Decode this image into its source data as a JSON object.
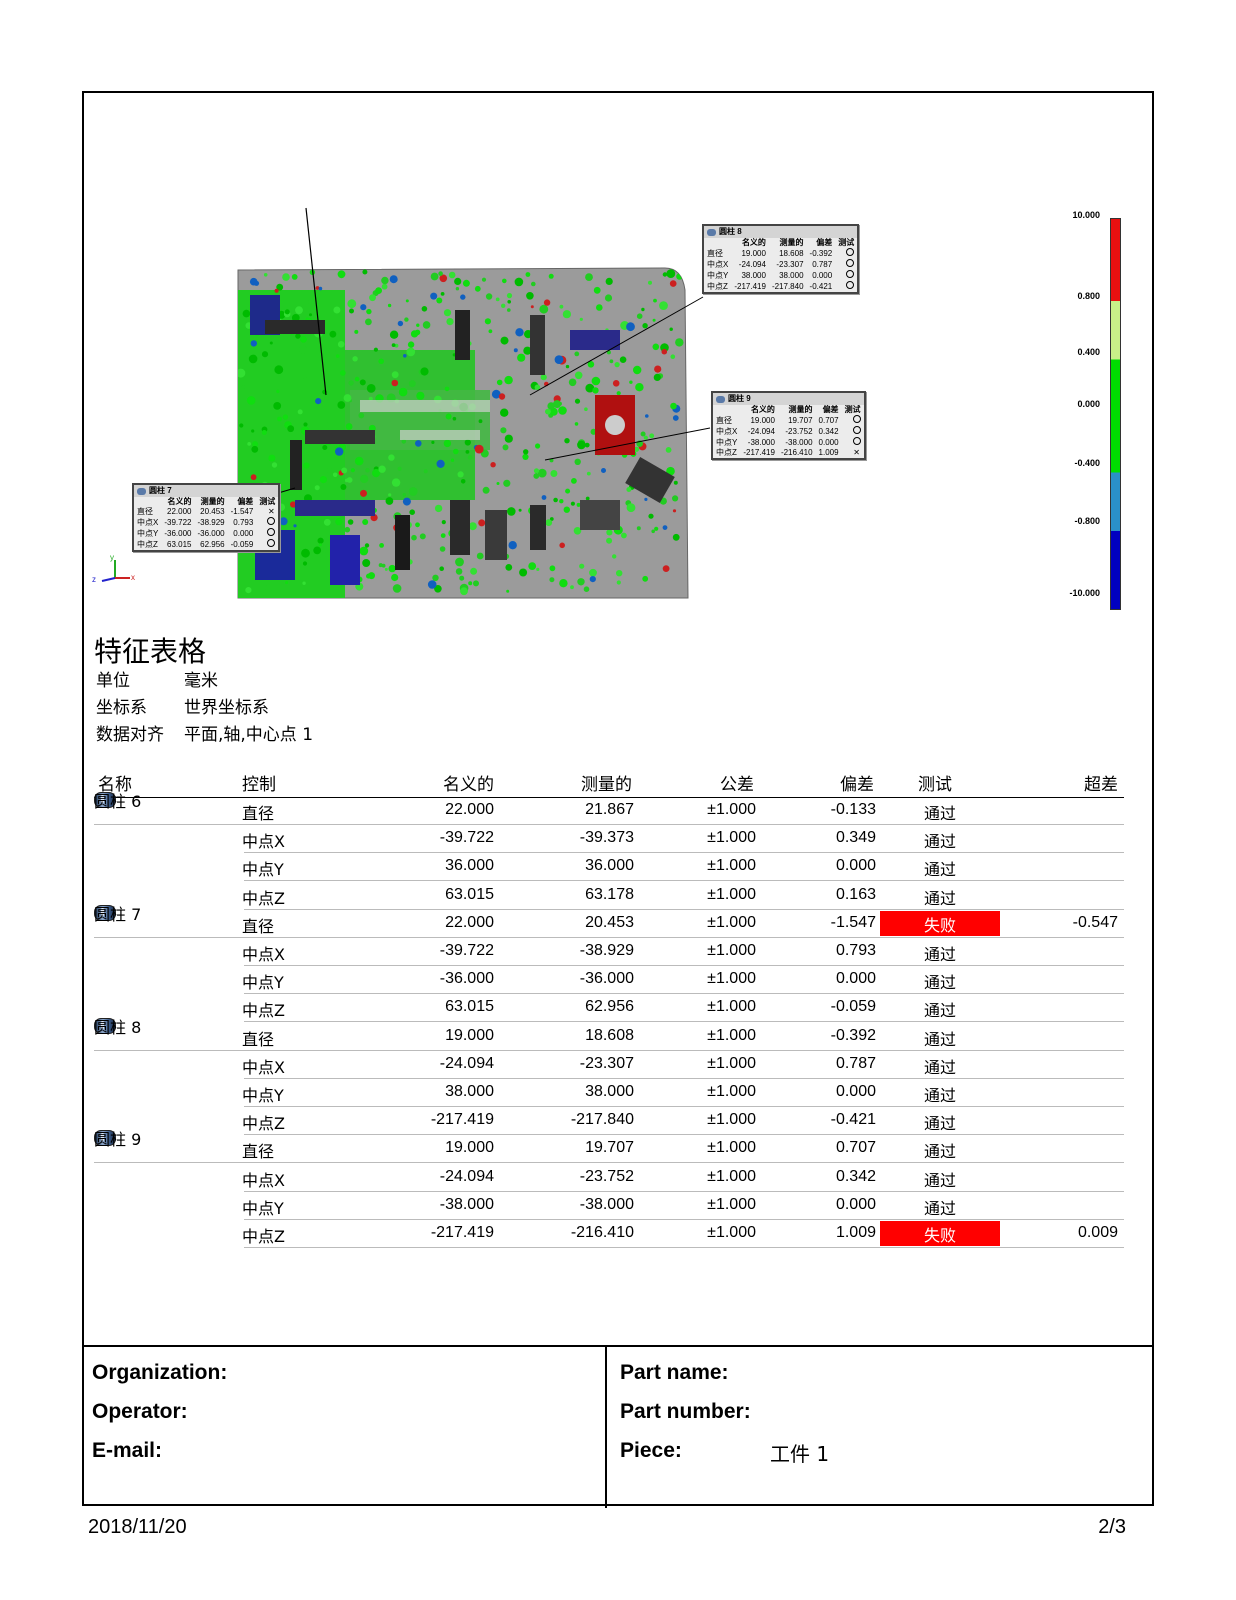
{
  "legend": {
    "labels": [
      "10.000",
      "0.800",
      "0.400",
      "0.000",
      "-0.400",
      "-0.800",
      "-10.000"
    ],
    "colors": {
      "high": "#e81010",
      "mid_high": "#c8f088",
      "mid": "#00dd00",
      "mid_low": "#2a90c8",
      "low": "#0000c0"
    }
  },
  "callouts": [
    {
      "title": "圆柱 8",
      "cols": [
        "",
        "名义的",
        "测量的",
        "偏差",
        "测试"
      ],
      "rows": [
        [
          "直径",
          "19.000",
          "18.608",
          "-0.392",
          "pass"
        ],
        [
          "中点X",
          "-24.094",
          "-23.307",
          "0.787",
          "pass"
        ],
        [
          "中点Y",
          "38.000",
          "38.000",
          "0.000",
          "pass"
        ],
        [
          "中点Z",
          "-217.419",
          "-217.840",
          "-0.421",
          "pass"
        ]
      ]
    },
    {
      "title": "圆柱 9",
      "cols": [
        "",
        "名义的",
        "测量的",
        "偏差",
        "测试"
      ],
      "rows": [
        [
          "直径",
          "19.000",
          "19.707",
          "0.707",
          "pass"
        ],
        [
          "中点X",
          "-24.094",
          "-23.752",
          "0.342",
          "pass"
        ],
        [
          "中点Y",
          "-38.000",
          "-38.000",
          "0.000",
          "pass"
        ],
        [
          "中点Z",
          "-217.419",
          "-216.410",
          "1.009",
          "fail"
        ]
      ]
    },
    {
      "title": "圆柱 7",
      "cols": [
        "",
        "名义的",
        "测量的",
        "偏差",
        "测试"
      ],
      "rows": [
        [
          "直径",
          "22.000",
          "20.453",
          "-1.547",
          "fail"
        ],
        [
          "中点X",
          "-39.722",
          "-38.929",
          "0.793",
          "pass"
        ],
        [
          "中点Y",
          "-36.000",
          "-36.000",
          "0.000",
          "pass"
        ],
        [
          "中点Z",
          "63.015",
          "62.956",
          "-0.059",
          "pass"
        ]
      ]
    }
  ],
  "axes": {
    "x": "x",
    "y": "y",
    "z": "z"
  },
  "title": "特征表格",
  "meta": [
    {
      "key": "单位",
      "value": "毫米"
    },
    {
      "key": "坐标系",
      "value": "世界坐标系"
    },
    {
      "key": "数据对齐",
      "value": "平面,轴,中心点 1"
    }
  ],
  "table": {
    "headers": {
      "name": "名称",
      "control": "控制",
      "nominal": "名义的",
      "measured": "测量的",
      "tolerance": "公差",
      "deviation": "偏差",
      "test": "测试",
      "out_of_tol": "超差"
    },
    "features": [
      {
        "name": "圆柱 6",
        "rows": [
          {
            "control": "直径",
            "nominal": "22.000",
            "measured": "21.867",
            "tolerance": "±1.000",
            "deviation": "-0.133",
            "test": "通过",
            "fail": false,
            "out": ""
          },
          {
            "control": "中点X",
            "nominal": "-39.722",
            "measured": "-39.373",
            "tolerance": "±1.000",
            "deviation": "0.349",
            "test": "通过",
            "fail": false,
            "out": ""
          },
          {
            "control": "中点Y",
            "nominal": "36.000",
            "measured": "36.000",
            "tolerance": "±1.000",
            "deviation": "0.000",
            "test": "通过",
            "fail": false,
            "out": ""
          },
          {
            "control": "中点Z",
            "nominal": "63.015",
            "measured": "63.178",
            "tolerance": "±1.000",
            "deviation": "0.163",
            "test": "通过",
            "fail": false,
            "out": ""
          }
        ]
      },
      {
        "name": "圆柱 7",
        "rows": [
          {
            "control": "直径",
            "nominal": "22.000",
            "measured": "20.453",
            "tolerance": "±1.000",
            "deviation": "-1.547",
            "test": "失败",
            "fail": true,
            "out": "-0.547"
          },
          {
            "control": "中点X",
            "nominal": "-39.722",
            "measured": "-38.929",
            "tolerance": "±1.000",
            "deviation": "0.793",
            "test": "通过",
            "fail": false,
            "out": ""
          },
          {
            "control": "中点Y",
            "nominal": "-36.000",
            "measured": "-36.000",
            "tolerance": "±1.000",
            "deviation": "0.000",
            "test": "通过",
            "fail": false,
            "out": ""
          },
          {
            "control": "中点Z",
            "nominal": "63.015",
            "measured": "62.956",
            "tolerance": "±1.000",
            "deviation": "-0.059",
            "test": "通过",
            "fail": false,
            "out": ""
          }
        ]
      },
      {
        "name": "圆柱 8",
        "rows": [
          {
            "control": "直径",
            "nominal": "19.000",
            "measured": "18.608",
            "tolerance": "±1.000",
            "deviation": "-0.392",
            "test": "通过",
            "fail": false,
            "out": ""
          },
          {
            "control": "中点X",
            "nominal": "-24.094",
            "measured": "-23.307",
            "tolerance": "±1.000",
            "deviation": "0.787",
            "test": "通过",
            "fail": false,
            "out": ""
          },
          {
            "control": "中点Y",
            "nominal": "38.000",
            "measured": "38.000",
            "tolerance": "±1.000",
            "deviation": "0.000",
            "test": "通过",
            "fail": false,
            "out": ""
          },
          {
            "control": "中点Z",
            "nominal": "-217.419",
            "measured": "-217.840",
            "tolerance": "±1.000",
            "deviation": "-0.421",
            "test": "通过",
            "fail": false,
            "out": ""
          }
        ]
      },
      {
        "name": "圆柱 9",
        "rows": [
          {
            "control": "直径",
            "nominal": "19.000",
            "measured": "19.707",
            "tolerance": "±1.000",
            "deviation": "0.707",
            "test": "通过",
            "fail": false,
            "out": ""
          },
          {
            "control": "中点X",
            "nominal": "-24.094",
            "measured": "-23.752",
            "tolerance": "±1.000",
            "deviation": "0.342",
            "test": "通过",
            "fail": false,
            "out": ""
          },
          {
            "control": "中点Y",
            "nominal": "-38.000",
            "measured": "-38.000",
            "tolerance": "±1.000",
            "deviation": "0.000",
            "test": "通过",
            "fail": false,
            "out": ""
          },
          {
            "control": "中点Z",
            "nominal": "-217.419",
            "measured": "-216.410",
            "tolerance": "±1.000",
            "deviation": "1.009",
            "test": "失败",
            "fail": true,
            "out": "0.009"
          }
        ]
      }
    ]
  },
  "footer": {
    "organization_label": "Organization:",
    "operator_label": "Operator:",
    "email_label": "E-mail:",
    "part_name_label": "Part name:",
    "part_number_label": "Part number:",
    "piece_label": "Piece:",
    "piece_value": "工件 1"
  },
  "date": "2018/11/20",
  "page": "2/3"
}
